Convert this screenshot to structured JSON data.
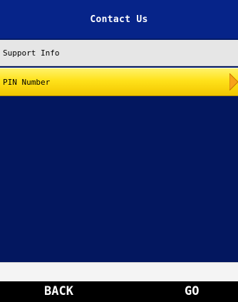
{
  "header": {
    "title": "Contact Us"
  },
  "menu": {
    "items": [
      {
        "label": "Support Info",
        "selected": false
      },
      {
        "label": "PIN Number",
        "selected": true
      }
    ]
  },
  "softkeys": {
    "left_label": "BACK",
    "right_label": "GO"
  },
  "colors": {
    "title_bar": "#062489",
    "background": "#03175f",
    "selected_row": "#ffe21a",
    "unselected_row": "#e6e6e6",
    "arrow": "#f7a21a",
    "softkey_bar": "#000000"
  },
  "icons": {
    "selected_row_indicator": "arrow-right-icon"
  }
}
